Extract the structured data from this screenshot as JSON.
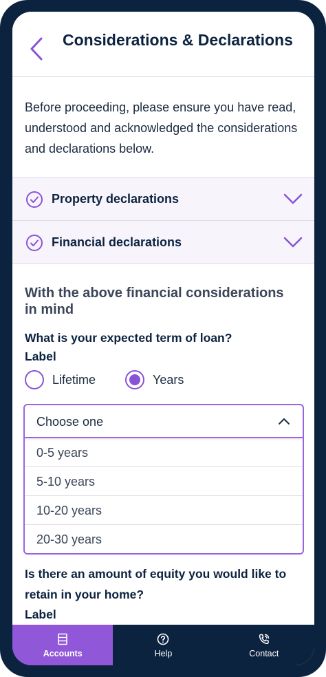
{
  "header": {
    "title": "Considerations & Declarations",
    "back_icon": "chevron-left-icon"
  },
  "intro": "Before proceeding, please ensure you have read, understood and acknowledged the considerations and declarations below.",
  "accordions": [
    {
      "label": "Property declarations",
      "status_icon": "check-circle-icon",
      "toggle_icon": "chevron-down-icon"
    },
    {
      "label": "Financial declarations",
      "status_icon": "check-circle-icon",
      "toggle_icon": "chevron-down-icon"
    }
  ],
  "section_title": "With the above financial considerations in mind",
  "loan_term": {
    "question": "What is your expected term of loan?",
    "label": "Label",
    "options": [
      {
        "label": "Lifetime",
        "selected": false
      },
      {
        "label": "Years",
        "selected": true
      }
    ],
    "select": {
      "placeholder": "Choose one",
      "expanded": true,
      "options": [
        "0-5 years",
        "5-10 years",
        "10-20 years",
        "20-30 years"
      ]
    }
  },
  "equity": {
    "question": "Is there an amount of equity you would like to retain in your home?",
    "label": "Label"
  },
  "bottom_nav": {
    "items": [
      {
        "label": "Accounts",
        "icon": "list-icon",
        "active": true
      },
      {
        "label": "Help",
        "icon": "help-circle-icon",
        "active": false
      },
      {
        "label": "Contact",
        "icon": "phone-icon",
        "active": false
      }
    ]
  },
  "colors": {
    "accent": "#8a52d6",
    "navy": "#0c2340",
    "accordion_bg": "#f7f5fb"
  }
}
